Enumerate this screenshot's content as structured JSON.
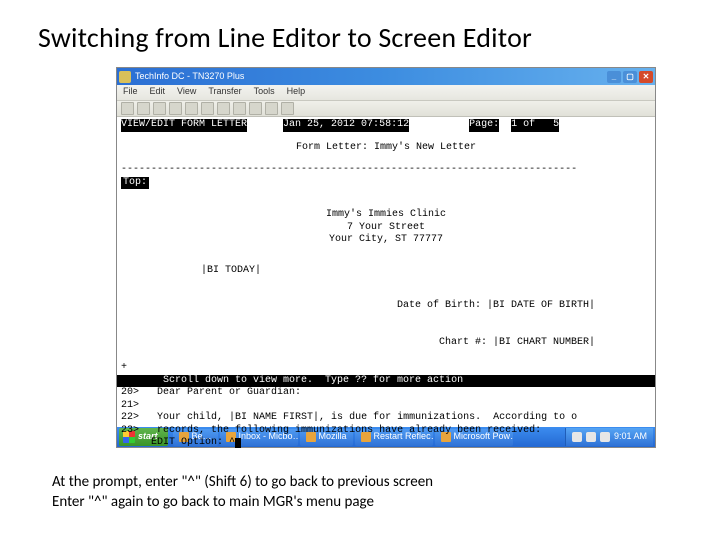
{
  "slide": {
    "title": "Switching from Line Editor to Screen Editor",
    "caption_line1": "At the prompt, enter \"^\" (Shift 6) to go back to previous screen",
    "caption_line2": "Enter \"^\" again to go back to main MGR's menu page"
  },
  "window": {
    "title": "TechInfo DC - TN3270 Plus",
    "menu": [
      "File",
      "Edit",
      "View",
      "Transfer",
      "Tools",
      "Help"
    ]
  },
  "terminal": {
    "header_left": "VIEW/EDIT FORM LETTER",
    "header_date": "Jan 25, 2012 07:58:12",
    "page_label": "Page:",
    "page_value": "1 of   5",
    "form_letter_label": "Form Letter: Immy's New Letter",
    "dashes": "----------------------------------------------------------------------------",
    "top_label": "Top:",
    "clinic_line1": "Immy's Immies Clinic",
    "clinic_line2": "7 Your Street",
    "clinic_line3": "Your City, ST  77777",
    "today_field": "|BI TODAY|",
    "dob_label": "Date of Birth:",
    "dob_field": "|BI DATE OF BIRTH|",
    "chart_label": "Chart #:",
    "chart_field": "|BI CHART NUMBER|",
    "plus": "+",
    "scroll_msg": "Scroll down to view more.  Type ?? for more action",
    "lines": [
      {
        "num": "20>",
        "text": "Dear Parent or Guardian:"
      },
      {
        "num": "21>",
        "text": ""
      },
      {
        "num": "22>",
        "text": "Your child, |BI NAME FIRST|, is due for immunizations.  According to o"
      },
      {
        "num": "23>",
        "text": "records, the following immunizations have already been received:"
      }
    ],
    "edit_prompt": "EDIT Option: ",
    "edit_value": "^"
  },
  "taskbar": {
    "start": "start",
    "items": [
      "Be…",
      "Inbox - Micbo…",
      "Mozilla",
      "Restart Reflec…",
      "Microsoft Pow…"
    ],
    "clock": "9:01 AM"
  }
}
